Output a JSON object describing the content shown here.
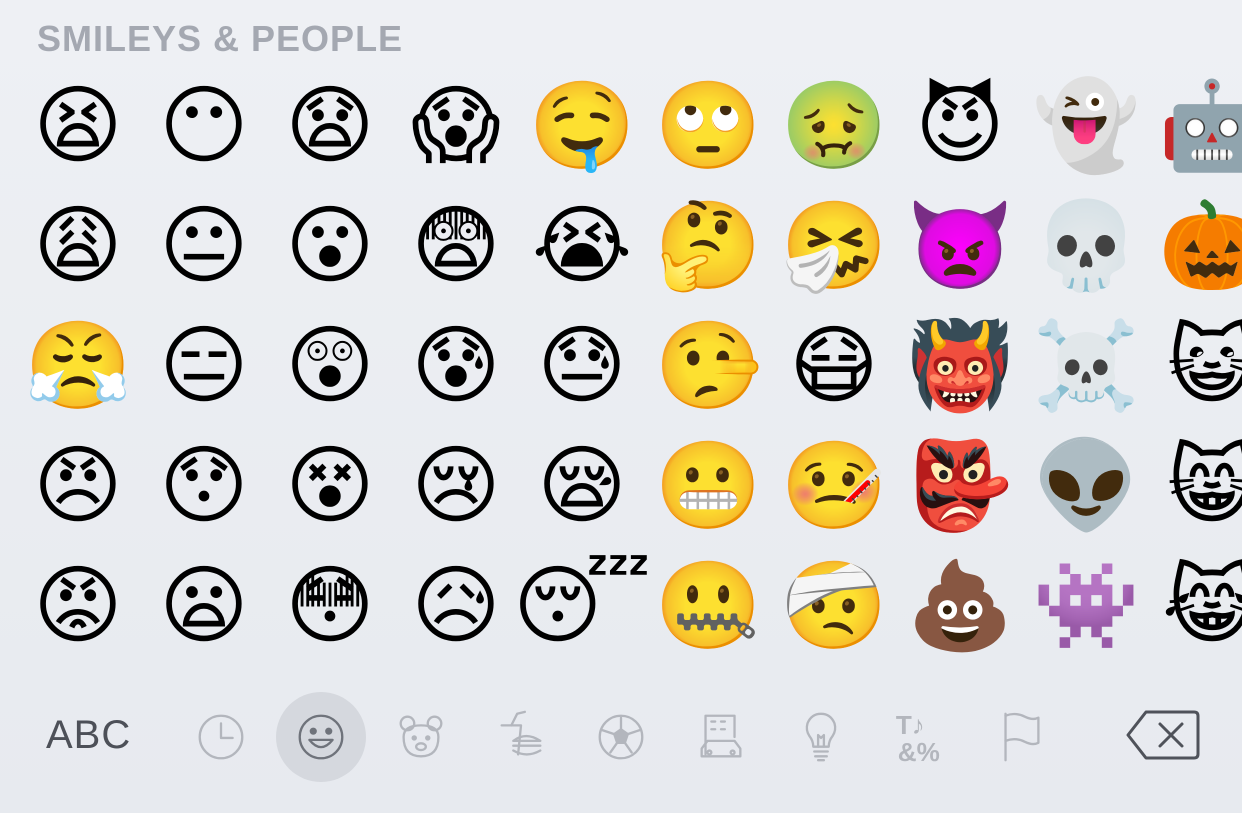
{
  "keyboard": {
    "section_title": "SMILEYS & PEOPLE",
    "emoji_rows": [
      [
        "😫",
        "😶",
        "😧",
        "😱",
        "🤤",
        "🙄",
        "🤢",
        "😈",
        "👻",
        "🤖"
      ],
      [
        "😩",
        "😐",
        "😮",
        "😨",
        "😭",
        "🤔",
        "🤧",
        "👿",
        "💀",
        "🎃"
      ],
      [
        "😤",
        "😑",
        "😲",
        "😰",
        "😓",
        "🤥",
        "😷",
        "👹",
        "☠️",
        "😺"
      ],
      [
        "😠",
        "😯",
        "😵",
        "😢",
        "😪",
        "😬",
        "🤒",
        "👺",
        "👽",
        "😸"
      ],
      [
        "😡",
        "😦",
        "😳",
        "😥",
        "😴",
        "🤐",
        "🤕",
        "💩",
        "👾",
        "😹"
      ]
    ],
    "bottom_bar": {
      "abc_label": "ABC",
      "categories": [
        {
          "icon": "clock-icon",
          "name": "recent"
        },
        {
          "icon": "smiley-icon",
          "name": "smileys-and-people",
          "active": true
        },
        {
          "icon": "bear-icon",
          "name": "animals-and-nature"
        },
        {
          "icon": "food-icon",
          "name": "food-and-drink"
        },
        {
          "icon": "soccer-ball-icon",
          "name": "activity"
        },
        {
          "icon": "car-building-icon",
          "name": "travel-and-places"
        },
        {
          "icon": "lightbulb-icon",
          "name": "objects"
        },
        {
          "icon": "symbols-icon",
          "name": "symbols"
        },
        {
          "icon": "flag-icon",
          "name": "flags"
        }
      ],
      "symbols_glyphs": {
        "top": "T♪",
        "bottom": "&%"
      }
    },
    "colors": {
      "background": "#eceef2",
      "title_gray": "#a4a8b1",
      "icon_gray": "#b3b6bd",
      "active_icon": "#6f737b",
      "active_bg": "#d5d8de",
      "dark_text": "#4d5058"
    }
  }
}
